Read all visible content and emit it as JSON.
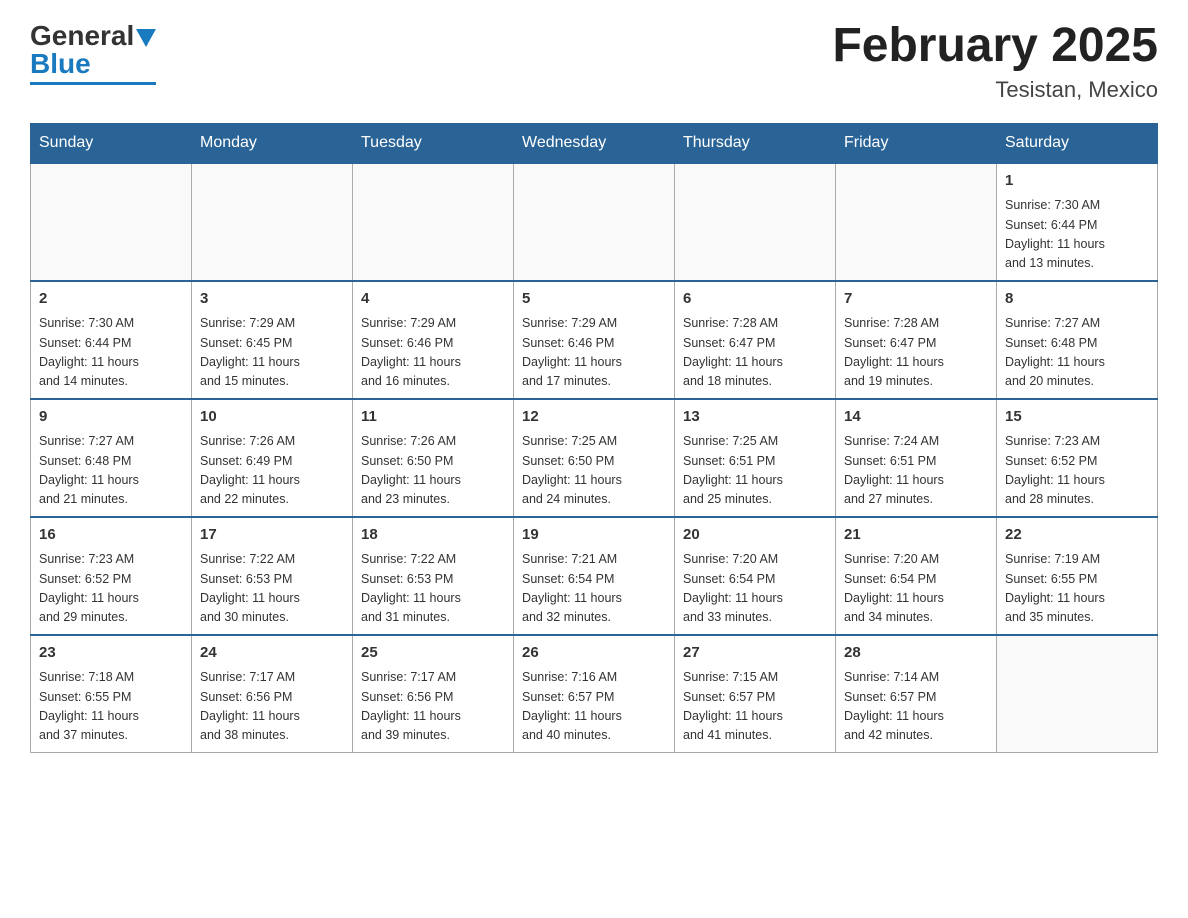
{
  "header": {
    "logo_general": "General",
    "logo_blue": "Blue",
    "month_title": "February 2025",
    "location": "Tesistan, Mexico"
  },
  "days_of_week": [
    "Sunday",
    "Monday",
    "Tuesday",
    "Wednesday",
    "Thursday",
    "Friday",
    "Saturday"
  ],
  "weeks": [
    [
      {
        "day": "",
        "info": ""
      },
      {
        "day": "",
        "info": ""
      },
      {
        "day": "",
        "info": ""
      },
      {
        "day": "",
        "info": ""
      },
      {
        "day": "",
        "info": ""
      },
      {
        "day": "",
        "info": ""
      },
      {
        "day": "1",
        "info": "Sunrise: 7:30 AM\nSunset: 6:44 PM\nDaylight: 11 hours\nand 13 minutes."
      }
    ],
    [
      {
        "day": "2",
        "info": "Sunrise: 7:30 AM\nSunset: 6:44 PM\nDaylight: 11 hours\nand 14 minutes."
      },
      {
        "day": "3",
        "info": "Sunrise: 7:29 AM\nSunset: 6:45 PM\nDaylight: 11 hours\nand 15 minutes."
      },
      {
        "day": "4",
        "info": "Sunrise: 7:29 AM\nSunset: 6:46 PM\nDaylight: 11 hours\nand 16 minutes."
      },
      {
        "day": "5",
        "info": "Sunrise: 7:29 AM\nSunset: 6:46 PM\nDaylight: 11 hours\nand 17 minutes."
      },
      {
        "day": "6",
        "info": "Sunrise: 7:28 AM\nSunset: 6:47 PM\nDaylight: 11 hours\nand 18 minutes."
      },
      {
        "day": "7",
        "info": "Sunrise: 7:28 AM\nSunset: 6:47 PM\nDaylight: 11 hours\nand 19 minutes."
      },
      {
        "day": "8",
        "info": "Sunrise: 7:27 AM\nSunset: 6:48 PM\nDaylight: 11 hours\nand 20 minutes."
      }
    ],
    [
      {
        "day": "9",
        "info": "Sunrise: 7:27 AM\nSunset: 6:48 PM\nDaylight: 11 hours\nand 21 minutes."
      },
      {
        "day": "10",
        "info": "Sunrise: 7:26 AM\nSunset: 6:49 PM\nDaylight: 11 hours\nand 22 minutes."
      },
      {
        "day": "11",
        "info": "Sunrise: 7:26 AM\nSunset: 6:50 PM\nDaylight: 11 hours\nand 23 minutes."
      },
      {
        "day": "12",
        "info": "Sunrise: 7:25 AM\nSunset: 6:50 PM\nDaylight: 11 hours\nand 24 minutes."
      },
      {
        "day": "13",
        "info": "Sunrise: 7:25 AM\nSunset: 6:51 PM\nDaylight: 11 hours\nand 25 minutes."
      },
      {
        "day": "14",
        "info": "Sunrise: 7:24 AM\nSunset: 6:51 PM\nDaylight: 11 hours\nand 27 minutes."
      },
      {
        "day": "15",
        "info": "Sunrise: 7:23 AM\nSunset: 6:52 PM\nDaylight: 11 hours\nand 28 minutes."
      }
    ],
    [
      {
        "day": "16",
        "info": "Sunrise: 7:23 AM\nSunset: 6:52 PM\nDaylight: 11 hours\nand 29 minutes."
      },
      {
        "day": "17",
        "info": "Sunrise: 7:22 AM\nSunset: 6:53 PM\nDaylight: 11 hours\nand 30 minutes."
      },
      {
        "day": "18",
        "info": "Sunrise: 7:22 AM\nSunset: 6:53 PM\nDaylight: 11 hours\nand 31 minutes."
      },
      {
        "day": "19",
        "info": "Sunrise: 7:21 AM\nSunset: 6:54 PM\nDaylight: 11 hours\nand 32 minutes."
      },
      {
        "day": "20",
        "info": "Sunrise: 7:20 AM\nSunset: 6:54 PM\nDaylight: 11 hours\nand 33 minutes."
      },
      {
        "day": "21",
        "info": "Sunrise: 7:20 AM\nSunset: 6:54 PM\nDaylight: 11 hours\nand 34 minutes."
      },
      {
        "day": "22",
        "info": "Sunrise: 7:19 AM\nSunset: 6:55 PM\nDaylight: 11 hours\nand 35 minutes."
      }
    ],
    [
      {
        "day": "23",
        "info": "Sunrise: 7:18 AM\nSunset: 6:55 PM\nDaylight: 11 hours\nand 37 minutes."
      },
      {
        "day": "24",
        "info": "Sunrise: 7:17 AM\nSunset: 6:56 PM\nDaylight: 11 hours\nand 38 minutes."
      },
      {
        "day": "25",
        "info": "Sunrise: 7:17 AM\nSunset: 6:56 PM\nDaylight: 11 hours\nand 39 minutes."
      },
      {
        "day": "26",
        "info": "Sunrise: 7:16 AM\nSunset: 6:57 PM\nDaylight: 11 hours\nand 40 minutes."
      },
      {
        "day": "27",
        "info": "Sunrise: 7:15 AM\nSunset: 6:57 PM\nDaylight: 11 hours\nand 41 minutes."
      },
      {
        "day": "28",
        "info": "Sunrise: 7:14 AM\nSunset: 6:57 PM\nDaylight: 11 hours\nand 42 minutes."
      },
      {
        "day": "",
        "info": ""
      }
    ]
  ]
}
